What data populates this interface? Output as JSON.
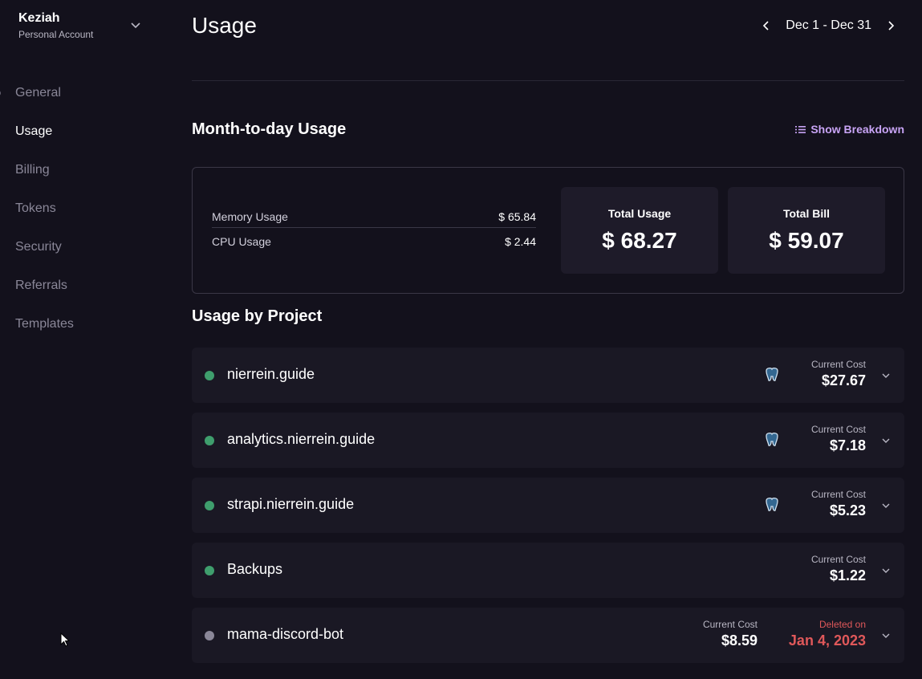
{
  "account": {
    "name": "Keziah",
    "subtitle": "Personal Account"
  },
  "nav": [
    {
      "label": "General"
    },
    {
      "label": "Usage",
      "active": true
    },
    {
      "label": "Billing"
    },
    {
      "label": "Tokens"
    },
    {
      "label": "Security"
    },
    {
      "label": "Referrals"
    },
    {
      "label": "Templates"
    }
  ],
  "page": {
    "title": "Usage",
    "date_range": "Dec 1 - Dec 31"
  },
  "month_usage": {
    "title": "Month-to-day Usage",
    "show_breakdown_label": "Show Breakdown",
    "memory_label": "Memory Usage",
    "memory_value": "$ 65.84",
    "cpu_label": "CPU Usage",
    "cpu_value": "$ 2.44",
    "total_usage_label": "Total Usage",
    "total_usage_value": "$ 68.27",
    "total_bill_label": "Total Bill",
    "total_bill_value": "$ 59.07"
  },
  "projects_section": {
    "title": "Usage by Project"
  },
  "projects": [
    {
      "name": "nierrein.guide",
      "cost_label": "Current Cost",
      "cost": "$27.67",
      "status_color": "#3f9e6d",
      "icon": "postgres-icon"
    },
    {
      "name": "analytics.nierrein.guide",
      "cost_label": "Current Cost",
      "cost": "$7.18",
      "status_color": "#3f9e6d",
      "icon": "postgres-icon"
    },
    {
      "name": "strapi.nierrein.guide",
      "cost_label": "Current Cost",
      "cost": "$5.23",
      "status_color": "#3f9e6d",
      "icon": "postgres-icon"
    },
    {
      "name": "Backups",
      "cost_label": "Current Cost",
      "cost": "$1.22",
      "status_color": "#3f9e6d"
    },
    {
      "name": "mama-discord-bot",
      "cost_label": "Current Cost",
      "cost": "$8.59",
      "deleted_label": "Deleted on",
      "deleted_date": "Jan 4, 2023",
      "status_color": "#8a8798"
    }
  ],
  "colors": {
    "background": "#13111c",
    "accent": "#c8a4f5",
    "danger": "#e0585a",
    "active_dot": "#3f9e6d"
  }
}
